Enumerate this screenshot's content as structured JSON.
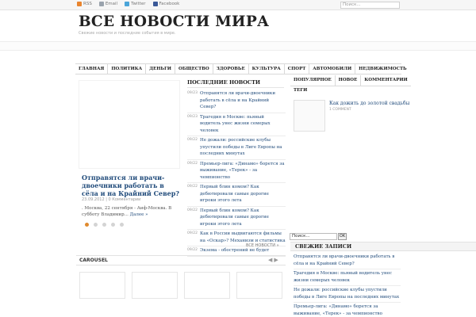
{
  "topbar": {
    "links": [
      {
        "label": "RSS",
        "icon": "rss-icon"
      },
      {
        "label": "Email",
        "icon": "email-icon"
      },
      {
        "label": "Twitter",
        "icon": "twitter-icon"
      },
      {
        "label": "Facebook",
        "icon": "facebook-icon"
      }
    ],
    "search_placeholder": "Поиск..."
  },
  "header": {
    "title": "ВСЕ НОВОСТИ МИРА",
    "description": "Свежие новости и последние события в мире."
  },
  "nav": {
    "items": [
      "ГЛАВНАЯ",
      "ПОЛИТИКА",
      "ДЕНЬГИ",
      "ОБЩЕСТВО",
      "ЗДОРОВЬЕ",
      "КУЛЬТУРА",
      "СПОРТ",
      "АВТОМОБИЛИ",
      "НЕДВИЖИМОСТЬ"
    ]
  },
  "featured": {
    "title": "Отправятся ли врачи-двоечники работать в сёла и на Крайний Север?",
    "date": "23.09.2012",
    "comments": "0 Комментарии",
    "excerpt": ". Москва, 22 сентября - Аиф-Москва. В субботу Владимир...",
    "more": "Далее »"
  },
  "latest": {
    "heading": "ПОСЛЕДНИЕ НОВОСТИ",
    "items": [
      {
        "date": "09/23",
        "title": "Отправятся ли врачи-двоечники работать в сёла и на Крайний Север?"
      },
      {
        "date": "09/23",
        "title": "Трагедия в Москве: пьяный водитель унес жизни семерых человек"
      },
      {
        "date": "09/22",
        "title": "Не дожали: российские клубы упустили победы в Лиге Европы на последних минутах"
      },
      {
        "date": "09/22",
        "title": "Премьер-лига: «Динамо» борется за выживание, «Терек» - за чемпионство"
      },
      {
        "date": "09/22",
        "title": "Первый блин комом? Как дебютировали самые дорогие игроки этого лета"
      },
      {
        "date": "09/22",
        "title": "Первый блин комом? Как дебютировали самые дорогие игроки этого лета"
      },
      {
        "date": "09/22",
        "title": "Как в России выдвигаются фильмы на «Оскар»? Механизм и статистика"
      },
      {
        "date": "09/22",
        "title": "Экзема - обострений не будет"
      }
    ],
    "all_link": "ВСЕ НОВОСТИ »"
  },
  "carousel": {
    "title": "CAROUSEL",
    "prev": "◀",
    "next": "▶"
  },
  "tabs": {
    "items": [
      "ПОПУЛЯРНОЕ",
      "НОВОЕ",
      "КОММЕНТАРИИ"
    ],
    "tags": "ТЕГИ",
    "popular_title": "Как дожить до золотой свадьбы",
    "popular_comments": "1 COMMENT"
  },
  "sidebar_search": {
    "value": "Поиск...",
    "button": "OK"
  },
  "recent": {
    "heading": "СВЕЖИЕ ЗАПИСИ",
    "items": [
      "Отправятся ли врачи-двоечники работать в сёла и на Крайний Север?",
      "Трагедия в Москве: пьяный водитель унес жизни семерых человек",
      "Не дожали: российские клубы упустили победы в Лиге Европы на последних минутах",
      "Премьер-лига: «Динамо» борется за выживание, «Терек» - за чемпионство"
    ]
  },
  "colors": {
    "link": "#1f4a7a",
    "accent": "#e08a2e",
    "rss": "#e9852f",
    "twitter": "#4ba5d9",
    "facebook": "#3b5998"
  }
}
